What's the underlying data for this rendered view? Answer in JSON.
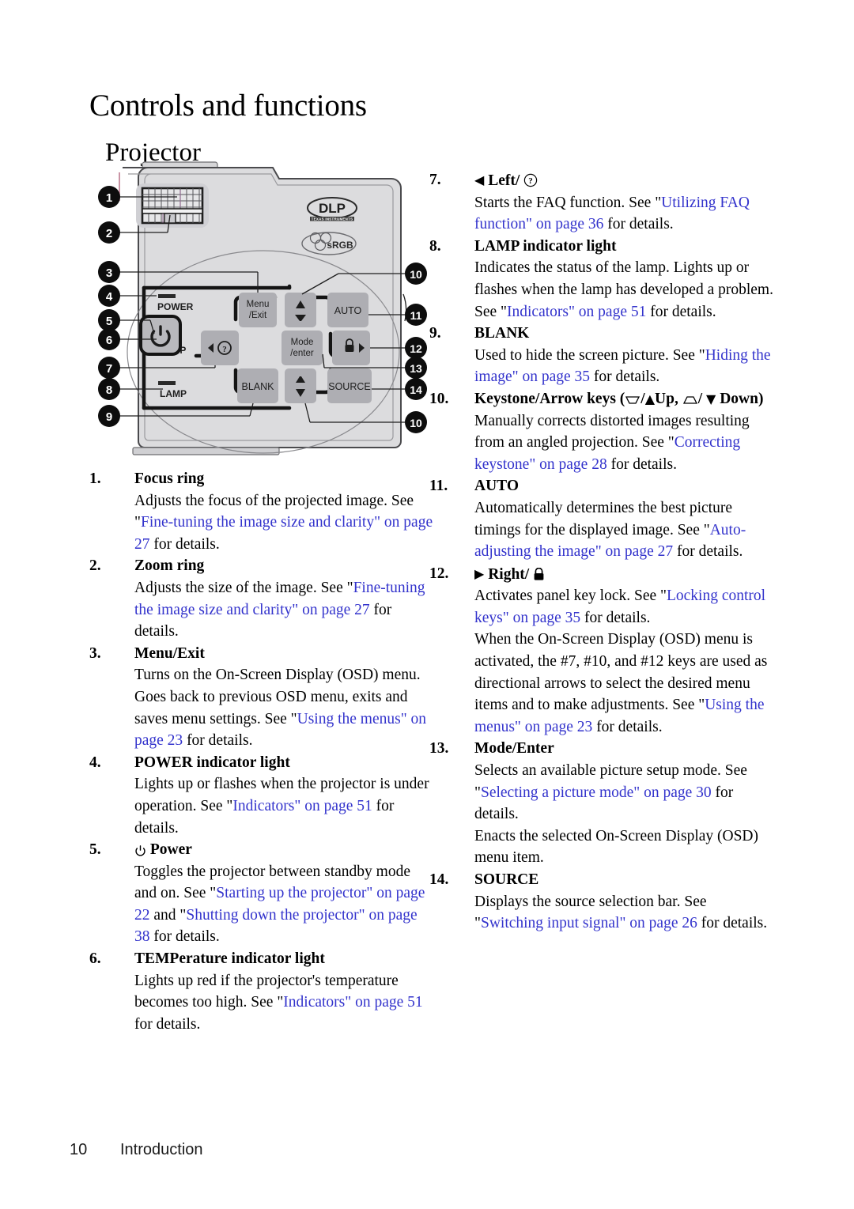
{
  "page": {
    "title": "Controls and functions",
    "subtitle": "Projector",
    "footer_page_number": "10",
    "footer_section": "Introduction",
    "link_color": "#3333CC"
  },
  "figure": {
    "name": "projector-top-panel-diagram",
    "logos": {
      "dlp": "DLP",
      "dlp_sub": "TEXAS INSTRUMENTS",
      "srgb": "sRGB"
    },
    "indicator_labels": [
      "POWER",
      "TEMP",
      "LAMP"
    ],
    "buttons": [
      {
        "name": "menu-exit-button",
        "line1": "Menu",
        "line2": "/Exit"
      },
      {
        "name": "keystone-up-button",
        "line1": "",
        "line2": ""
      },
      {
        "name": "auto-button",
        "line1": "AUTO",
        "line2": ""
      },
      {
        "name": "power-button",
        "line1": "",
        "line2": ""
      },
      {
        "name": "left-faq-button",
        "line1": "",
        "line2": ""
      },
      {
        "name": "mode-enter-button",
        "line1": "Mode",
        "line2": "/enter"
      },
      {
        "name": "right-lock-button",
        "line1": "",
        "line2": ""
      },
      {
        "name": "blank-button",
        "line1": "BLANK",
        "line2": ""
      },
      {
        "name": "keystone-down-button",
        "line1": "",
        "line2": ""
      },
      {
        "name": "source-button",
        "line1": "SOURCE",
        "line2": ""
      }
    ],
    "callouts_left": [
      "1",
      "2",
      "3",
      "4",
      "5",
      "6",
      "7",
      "8",
      "9"
    ],
    "callouts_right": [
      "10",
      "11",
      "12",
      "13",
      "14",
      "10"
    ]
  },
  "left_column": [
    {
      "num": "1.",
      "header": "Focus ring",
      "desc": [
        {
          "t": "Adjusts the focus of the projected image. See \"",
          "link": false
        },
        {
          "t": "Fine-tuning the image size and clarity\" on page 27",
          "link": true
        },
        {
          "t": " for details.",
          "link": false
        }
      ]
    },
    {
      "num": "2.",
      "header": "Zoom ring",
      "desc": [
        {
          "t": "Adjusts the size of the image. See \"",
          "link": false
        },
        {
          "t": "Fine-tuning the image size and clarity\" on page 27",
          "link": true
        },
        {
          "t": " for details.",
          "link": false
        }
      ]
    },
    {
      "num": "3.",
      "header": "Menu/Exit",
      "desc": [
        {
          "t": "Turns on the On-Screen Display (OSD) menu. Goes back to previous OSD menu, exits and saves menu settings. See \"",
          "link": false
        },
        {
          "t": "Using the menus\" on page 23",
          "link": true
        },
        {
          "t": " for details.",
          "link": false
        }
      ]
    },
    {
      "num": "4.",
      "header": "POWER indicator light",
      "desc": [
        {
          "t": "Lights up or flashes when the projector is under operation. See \"",
          "link": false
        },
        {
          "t": "Indicators\" on page 51",
          "link": true
        },
        {
          "t": " for details.",
          "link": false
        }
      ]
    },
    {
      "num": "5.",
      "header": "Power",
      "header_icon": "power-icon",
      "desc": [
        {
          "t": "Toggles the projector between standby mode and on. See \"",
          "link": false
        },
        {
          "t": "Starting up the projector\" on page 22",
          "link": true
        },
        {
          "t": " and \"",
          "link": false
        },
        {
          "t": "Shutting down the projector\" on page 38",
          "link": true
        },
        {
          "t": " for details.",
          "link": false
        }
      ]
    },
    {
      "num": "6.",
      "header": "TEMPerature indicator light",
      "desc": [
        {
          "t": "Lights up red if the projector's temperature becomes too high. See \"",
          "link": false
        },
        {
          "t": "Indicators\" on page 51",
          "link": true
        },
        {
          "t": " for details.",
          "link": false
        }
      ]
    }
  ],
  "right_column": [
    {
      "num": "7.",
      "header": "Left/",
      "header_prefix_icon": "triangle-left-icon",
      "header_suffix_icon": "question-circle-icon",
      "desc": [
        {
          "t": "Starts the FAQ function. See \"",
          "link": false
        },
        {
          "t": "Utilizing FAQ function\" on page 36",
          "link": true
        },
        {
          "t": " for details.",
          "link": false
        }
      ]
    },
    {
      "num": "8.",
      "header": "LAMP indicator light",
      "desc": [
        {
          "t": "Indicates the status of the lamp. Lights up or flashes when the lamp has developed a problem. See \"",
          "link": false
        },
        {
          "t": "Indicators\" on page 51",
          "link": true
        },
        {
          "t": " for details.",
          "link": false
        }
      ]
    },
    {
      "num": "9.",
      "header": "BLANK",
      "desc": [
        {
          "t": "Used to hide the screen picture. See \"",
          "link": false
        },
        {
          "t": "Hiding the image\" on page 35",
          "link": true
        },
        {
          "t": " for details.",
          "link": false
        }
      ]
    },
    {
      "num": "10.",
      "header": "Keystone/Arrow keys (",
      "header_mid": "Up,",
      "header_end": "Down)",
      "header_icons": [
        "keystone-narrow-bottom-icon",
        "triangle-up-icon",
        "keystone-wide-bottom-icon",
        "triangle-down-icon"
      ],
      "desc": [
        {
          "t": "Manually corrects distorted images resulting from an angled projection. See \"",
          "link": false
        },
        {
          "t": "Correcting keystone\" on page 28",
          "link": true
        },
        {
          "t": " for details.",
          "link": false
        }
      ]
    },
    {
      "num": "11.",
      "header": "AUTO",
      "desc": [
        {
          "t": "Automatically determines the best picture timings for the displayed image. See \"",
          "link": false
        },
        {
          "t": "Auto-adjusting the image\" on page 27",
          "link": true
        },
        {
          "t": " for details.",
          "link": false
        }
      ]
    },
    {
      "num": "12.",
      "header": "Right/",
      "header_prefix_icon": "triangle-right-icon",
      "header_suffix_icon": "padlock-icon",
      "desc": [
        {
          "t": "Activates panel key lock. See \"",
          "link": false
        },
        {
          "t": "Locking control keys\" on page 35",
          "link": true
        },
        {
          "t": " for details.",
          "link": false
        }
      ],
      "desc2": [
        {
          "t": "When the On-Screen Display (OSD) menu is activated, the #7, #10, and #12 keys are used as directional arrows to select the desired menu items and to make adjustments. See \"",
          "link": false
        },
        {
          "t": "Using the menus\" on page 23",
          "link": true
        },
        {
          "t": " for details.",
          "link": false
        }
      ]
    },
    {
      "num": "13.",
      "header": "Mode/Enter",
      "desc": [
        {
          "t": "Selects an available picture setup mode. See \"",
          "link": false
        },
        {
          "t": "Selecting a picture mode\" on page 30",
          "link": true
        },
        {
          "t": " for details.",
          "link": false
        }
      ],
      "desc2": [
        {
          "t": "Enacts the selected On-Screen Display (OSD) menu item.",
          "link": false
        }
      ]
    },
    {
      "num": "14.",
      "header": "SOURCE",
      "desc": [
        {
          "t": "Displays the source selection bar. See \"",
          "link": false
        },
        {
          "t": "Switching input signal\" on page 26",
          "link": true
        },
        {
          "t": " for details.",
          "link": false
        }
      ]
    }
  ]
}
